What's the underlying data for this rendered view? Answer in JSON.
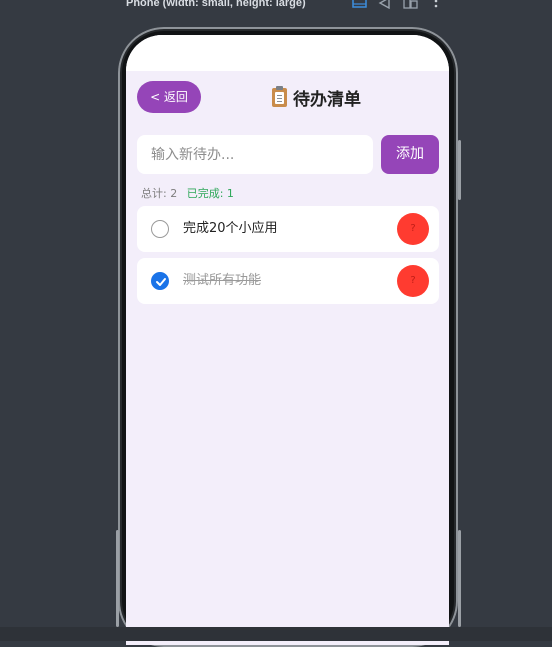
{
  "toolbar": {
    "device_label": "Phone (width: small, height: large)",
    "icons": [
      "layout-icon",
      "rotate-icon",
      "multi-device-icon",
      "more-icon"
    ]
  },
  "header": {
    "back_label": "< 返回",
    "title": "待办清单",
    "title_icon": "clipboard-icon"
  },
  "input": {
    "placeholder": "输入新待办...",
    "value": "",
    "add_label": "添加"
  },
  "stats": {
    "total": "总计: 2",
    "completed": "已完成: 1"
  },
  "todos": [
    {
      "text": "完成20个小应用",
      "completed": false,
      "delete_icon": "?"
    },
    {
      "text": "测试所有功能",
      "completed": true,
      "delete_icon": "?"
    }
  ],
  "colors": {
    "accent": "#9545b8",
    "delete": "#ff3b30",
    "checked": "#1a73e8",
    "completed_text": "#2fa85a",
    "screen_background": "#f3eefa"
  }
}
